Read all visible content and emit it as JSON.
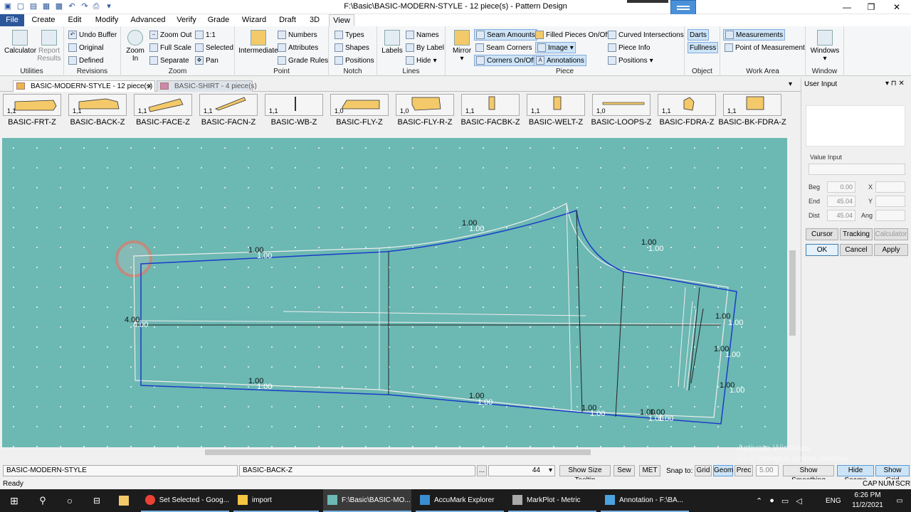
{
  "window": {
    "title": "F:\\Basic\\BASIC-MODERN-STYLE - 12 piece(s) - Pattern Design"
  },
  "menu": [
    "File",
    "Create",
    "Edit",
    "Modify",
    "Advanced",
    "Verify",
    "Grade",
    "Wizard",
    "Draft",
    "3D",
    "View"
  ],
  "ribbon": {
    "utilities": {
      "label": "Utilities",
      "calculator": "Calculator",
      "report1": "Report",
      "report2": "Results"
    },
    "revisions": {
      "label": "Revisions",
      "undo_buffer": "Undo Buffer",
      "original": "Original",
      "defined": "Defined"
    },
    "zoom": {
      "label": "Zoom",
      "zoom_in1": "Zoom",
      "zoom_in2": "In",
      "zoom_out": "Zoom Out",
      "full_scale": "Full Scale",
      "separate": "Separate",
      "one_one": "1:1",
      "selected": "Selected",
      "pan": "Pan"
    },
    "point": {
      "label": "Point",
      "intermediate": "Intermediate",
      "numbers": "Numbers",
      "attributes": "Attributes",
      "grade_rules": "Grade Rules"
    },
    "notch": {
      "label": "Notch",
      "types": "Types",
      "shapes": "Shapes",
      "positions": "Positions"
    },
    "lines": {
      "label": "Lines",
      "labels": "Labels",
      "names": "Names",
      "by_label": "By Label",
      "hide": "Hide"
    },
    "piece": {
      "label": "Piece",
      "mirror": "Mirror",
      "seam_amounts": "Seam Amounts",
      "seam_corners": "Seam Corners",
      "corners_onoff": "Corners On/Off",
      "filled_pieces": "Filled Pieces On/Off",
      "image": "Image",
      "annotations": "Annotations",
      "curved_intersections": "Curved Intersections",
      "piece_info": "Piece Info",
      "positions": "Positions"
    },
    "object": {
      "label": "Object",
      "darts": "Darts",
      "fullness": "Fullness"
    },
    "work_area": {
      "label": "Work Area",
      "measurements": "Measurements",
      "point_of_measurement": "Point of Measurement"
    },
    "window": {
      "label": "Window",
      "windows": "Windows"
    }
  },
  "doc_tabs": [
    {
      "label": "BASIC-MODERN-STYLE - 12 piece(s)",
      "close": "×"
    },
    {
      "label": "BASIC-SHIRT - 4 piece(s)"
    }
  ],
  "pieces": [
    {
      "name": "BASIC-FRT-Z",
      "size": "1,1"
    },
    {
      "name": "BASIC-BACK-Z",
      "size": "1,1"
    },
    {
      "name": "BASIC-FACE-Z",
      "size": "1,1"
    },
    {
      "name": "BASIC-FACN-Z",
      "size": "1,1"
    },
    {
      "name": "BASIC-WB-Z",
      "size": "1,1"
    },
    {
      "name": "BASIC-FLY-Z",
      "size": "1,0"
    },
    {
      "name": "BASIC-FLY-R-Z",
      "size": "1,0"
    },
    {
      "name": "BASIC-FACBK-Z",
      "size": "1,1"
    },
    {
      "name": "BASIC-WELT-Z",
      "size": "1,1"
    },
    {
      "name": "BASIC-LOOPS-Z",
      "size": "1,0"
    },
    {
      "name": "BASIC-FDRA-Z",
      "size": "1,1"
    },
    {
      "name": "BASIC-BK-FDRA-Z",
      "size": "1,1"
    }
  ],
  "canvas": {
    "seam_labels": [
      "1.00",
      "1.00",
      "1.00",
      "1.00",
      "1.00",
      "1.00",
      "4.00",
      "4.00",
      "1.00",
      "1.00",
      "1.00",
      "1.00",
      "1.00",
      "1.00",
      "1.00",
      "1.00",
      "1.00",
      "1.00",
      "1.00",
      "1.00",
      "1.00",
      "1.00",
      "1.00",
      "1.00"
    ]
  },
  "user_input": {
    "title": "User Input",
    "value_input": "Value Input",
    "beg_label": "Beg",
    "end_label": "End",
    "dist_label": "Dist",
    "beg": "0.00",
    "end": "45.04",
    "dist": "45.04",
    "x_label": "X",
    "y_label": "Y",
    "ang_label": "Ang",
    "cursor": "Cursor",
    "tracking": "Tracking",
    "calculator": "Calculator",
    "ok": "OK",
    "cancel": "Cancel",
    "apply": "Apply"
  },
  "status": {
    "style": "BASIC-MODERN-STYLE",
    "piece": "BASIC-BACK-Z",
    "ellipsis": "...",
    "size": "44",
    "show_size_tooltip": "Show Size Tooltip",
    "sew": "Sew",
    "met": "MET",
    "snap_to": "Snap to:",
    "grid": "Grid",
    "geom": "Geom",
    "prec": "Prec",
    "prec_value": "5.00",
    "show_smoothing": "Show Smoothing",
    "hide_seams": "Hide Seams",
    "show_grid": "Show Grid",
    "ready": "Ready",
    "cap": "CAP",
    "num": "NUM",
    "scrl": "SCRL"
  },
  "watermark": {
    "line1": "Activate Windows",
    "line2": "Go to Settings to activate Windows."
  },
  "taskbar": {
    "items": [
      "Set Selected - Goog...",
      "import",
      "F:\\Basic\\BASIC-MO...",
      "AccuMark Explorer",
      "MarkPlot - Metric",
      "Annotation - F:\\BA..."
    ],
    "lang": "ENG",
    "time": "6:26 PM",
    "date": "11/2/2021"
  }
}
